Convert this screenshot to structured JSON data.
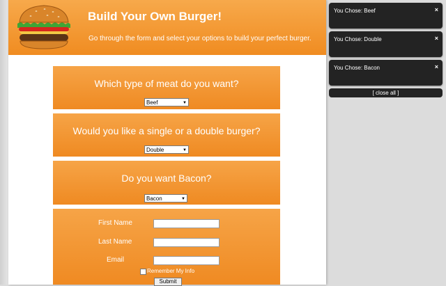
{
  "header": {
    "title": "Build Your Own Burger!",
    "subtitle": "Go through the form and select your options to build your perfect burger."
  },
  "form": {
    "meat": {
      "question": "Which type of meat do you want?",
      "selected": "Beef"
    },
    "size": {
      "question": "Would you like a single or a double burger?",
      "selected": "Double"
    },
    "bacon": {
      "question": "Do you want Bacon?",
      "selected": "Bacon"
    },
    "first_name_label": "First Name",
    "last_name_label": "Last Name",
    "email_label": "Email",
    "remember_label": "Remember My Info",
    "submit_label": "Submit"
  },
  "notifications": {
    "items": [
      {
        "text": "You Chose: Beef"
      },
      {
        "text": "You Chose: Double"
      },
      {
        "text": "You Chose: Bacon"
      }
    ],
    "close_symbol": "×",
    "close_all_label": "[ close all ]"
  }
}
